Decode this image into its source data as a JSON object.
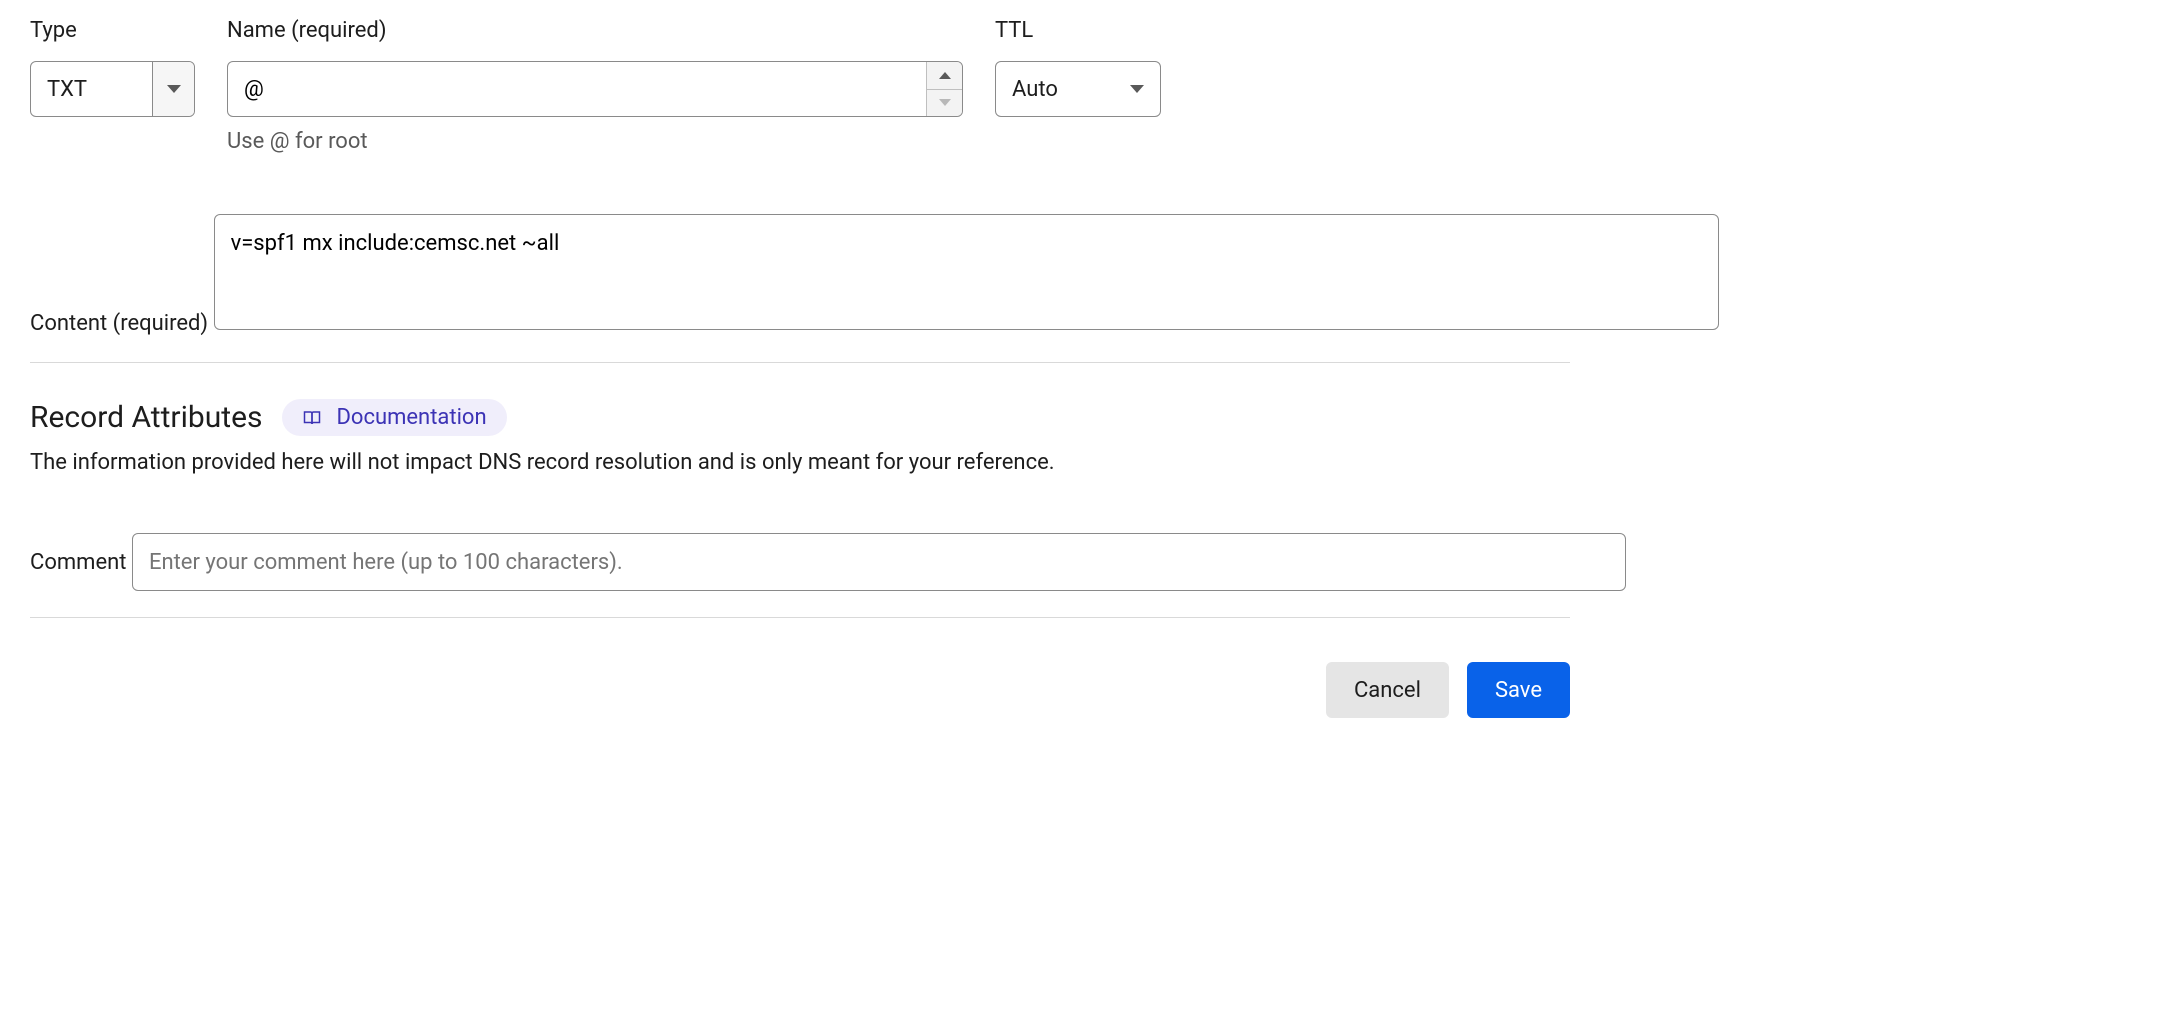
{
  "form": {
    "type": {
      "label": "Type",
      "value": "TXT"
    },
    "name": {
      "label": "Name (required)",
      "value": "@",
      "helper": "Use @ for root"
    },
    "ttl": {
      "label": "TTL",
      "value": "Auto"
    },
    "content": {
      "label": "Content (required)",
      "value": "v=spf1 mx include:cemsc.net ~all"
    }
  },
  "attributes": {
    "title": "Record Attributes",
    "documentation_label": "Documentation",
    "description": "The information provided here will not impact DNS record resolution and is only meant for your reference.",
    "comment": {
      "label": "Comment",
      "placeholder": "Enter your comment here (up to 100 characters)."
    }
  },
  "actions": {
    "cancel": "Cancel",
    "save": "Save"
  }
}
